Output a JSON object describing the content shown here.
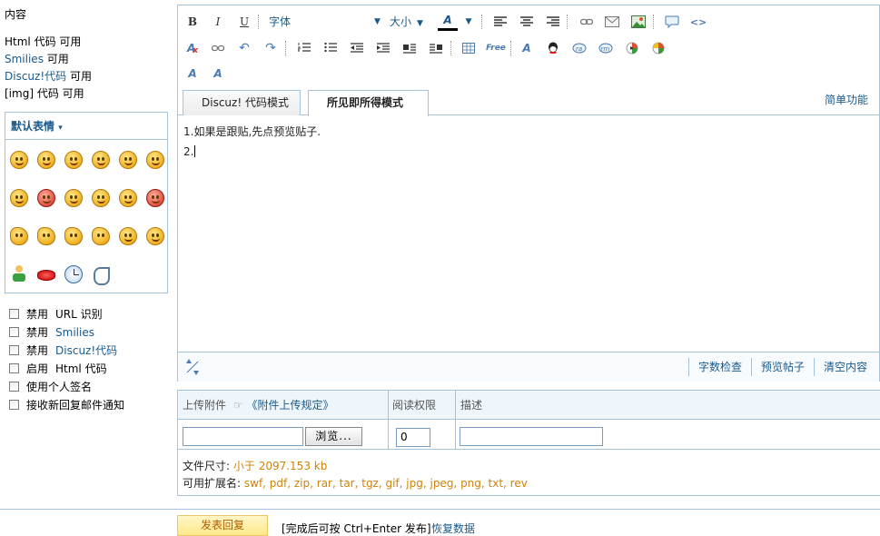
{
  "left": {
    "content_label": "内容",
    "rules": [
      {
        "name": "Html 代码",
        "status": "可用",
        "link": false
      },
      {
        "name": "Smilies",
        "status": "可用",
        "link": true
      },
      {
        "name": "Discuz!代码",
        "status": "可用",
        "link": true
      },
      {
        "name": "[img] 代码",
        "status": "可用",
        "link": false
      }
    ],
    "smilies_title": "默认表情",
    "smilies": [
      "smile-icon",
      "sad-icon",
      "tongue-icon",
      "shy-icon",
      "grin-icon",
      "wink-icon",
      "sleepy-icon",
      "angry-icon",
      "shocked-icon",
      "cry-icon",
      "confused-icon",
      "love-icon",
      "thumbs-up-icon",
      "thumbs-down-icon",
      "victory-icon",
      "handshake-icon",
      "laugh-icon",
      "cool-icon",
      "man-icon",
      "lips-icon",
      "clock-icon",
      "phone-icon"
    ],
    "options": [
      {
        "prefix": "禁用",
        "label": "URL 识别",
        "blue": false
      },
      {
        "prefix": "禁用",
        "label": "Smilies",
        "blue": true
      },
      {
        "prefix": "禁用",
        "label": "Discuz!代码",
        "blue": true
      },
      {
        "prefix": "启用",
        "label": "Html 代码",
        "blue": false
      },
      {
        "prefix": "",
        "label": "使用个人签名",
        "blue": false
      },
      {
        "prefix": "",
        "label": "接收新回复邮件通知",
        "blue": false
      }
    ]
  },
  "toolbar": {
    "bold": "B",
    "italic": "I",
    "underline": "U",
    "font_label": "字体",
    "size_label": "大小",
    "color_label": "A",
    "free_label": "Free"
  },
  "modes": {
    "code_mode": "Discuz! 代码模式",
    "wysiwyg_mode": "所见即所得模式",
    "simple": "简单功能"
  },
  "content": {
    "line1": "1.如果是跟贴,先点预览贴子.",
    "line2": "2."
  },
  "statusbar": {
    "count": "字数检查",
    "preview": "预览帖子",
    "clear": "清空内容"
  },
  "attach": {
    "upload_label": "上传附件",
    "rules_link": "《附件上传规定》",
    "perm_label": "阅读权限",
    "desc_label": "描述",
    "browse_label": "浏览...",
    "perm_value": "0",
    "size_label": "文件尺寸:",
    "size_value": "小于 2097.153 kb",
    "ext_label": "可用扩展名:",
    "ext_value": "swf, pdf, zip, rar, tar, tgz, gif, jpg, jpeg, png, txt, rev"
  },
  "bottom": {
    "submit": "发表回复",
    "hint": "[完成后可按 Ctrl+Enter 发布]",
    "restore": "恢复数据"
  }
}
